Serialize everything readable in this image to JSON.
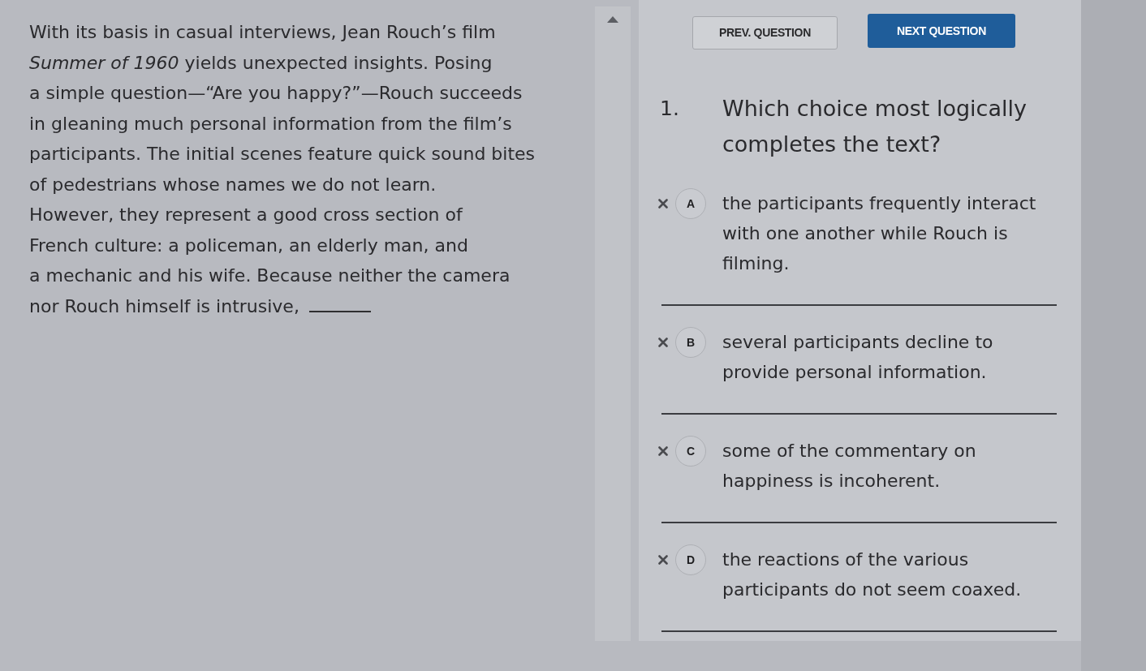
{
  "passage": {
    "lines": [
      "With its basis in casual interviews, Jean Rouch’s film",
      "*Summer of 1960* yields unexpected insights. Posing",
      "a simple question—“Are you happy?”—Rouch succeeds",
      "in gleaning much personal information from the film’s",
      "participants. The initial scenes feature quick sound bites",
      "of pedestrians whose names we do not learn.",
      "However, they represent a good cross section of",
      "French culture: a policeman, an elderly man, and",
      "a mechanic and his wife. Because neither the camera",
      "nor Rouch himself is intrusive,"
    ],
    "blank": true
  },
  "navigation": [
    {
      "label": "PREV. QUESTION",
      "kind": "secondary"
    },
    {
      "label": "NEXT QUESTION",
      "kind": "primary"
    }
  ],
  "question": {
    "number": "1.",
    "text": "Which choice most logically completes the text?"
  },
  "choices": [
    {
      "letter": "A",
      "text": "the participants frequently interact with one another while Rouch is filming."
    },
    {
      "letter": "B",
      "text": "several participants decline to provide personal information."
    },
    {
      "letter": "C",
      "text": "some of the commentary on happiness is incoherent."
    },
    {
      "letter": "D",
      "text": "the reactions of the various participants do not seem coaxed."
    }
  ]
}
